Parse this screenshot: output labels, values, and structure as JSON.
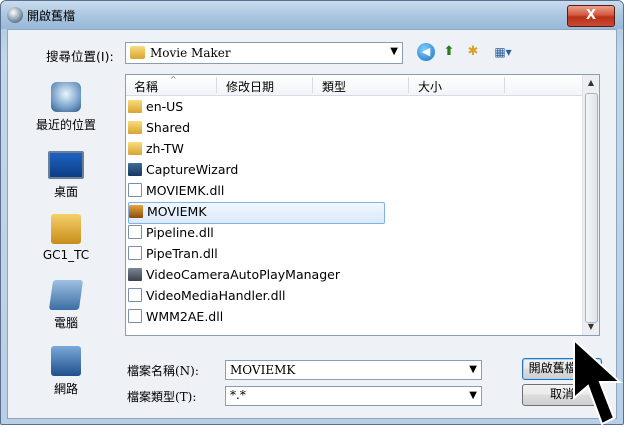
{
  "window": {
    "title": "開啟舊檔",
    "close_label": "X"
  },
  "look_in": {
    "label": "搜尋位置(I):",
    "value": "Movie Maker"
  },
  "places": [
    {
      "label": "最近的位置",
      "icon": "recent-places-icon"
    },
    {
      "label": "桌面",
      "icon": "desktop-icon"
    },
    {
      "label": "GC1_TC",
      "icon": "user-folder-icon"
    },
    {
      "label": "電腦",
      "icon": "computer-icon"
    },
    {
      "label": "網路",
      "icon": "network-icon"
    }
  ],
  "columns": [
    "名稱",
    "修改日期",
    "類型",
    "大小"
  ],
  "files": [
    {
      "name": "en-US",
      "type": "folder"
    },
    {
      "name": "Shared",
      "type": "folder"
    },
    {
      "name": "zh-TW",
      "type": "folder"
    },
    {
      "name": "CaptureWizard",
      "type": "exe"
    },
    {
      "name": "MOVIEMK.dll",
      "type": "dll"
    },
    {
      "name": "MOVIEMK",
      "type": "app",
      "selected": true
    },
    {
      "name": "Pipeline.dll",
      "type": "dll"
    },
    {
      "name": "PipeTran.dll",
      "type": "dll"
    },
    {
      "name": "VideoCameraAutoPlayManager",
      "type": "camera"
    },
    {
      "name": "VideoMediaHandler.dll",
      "type": "dll"
    },
    {
      "name": "WMM2AE.dll",
      "type": "dll"
    }
  ],
  "filename": {
    "label": "檔案名稱(N):",
    "value": "MOVIEMK"
  },
  "filetype": {
    "label": "檔案類型(T):",
    "value": "*.*"
  },
  "buttons": {
    "open": "開啟舊檔(O)",
    "cancel": "取消"
  },
  "colors": {
    "selection_border": "#7fb3e8",
    "default_button_border": "#2b71c4",
    "close_button": "#c94a30"
  }
}
